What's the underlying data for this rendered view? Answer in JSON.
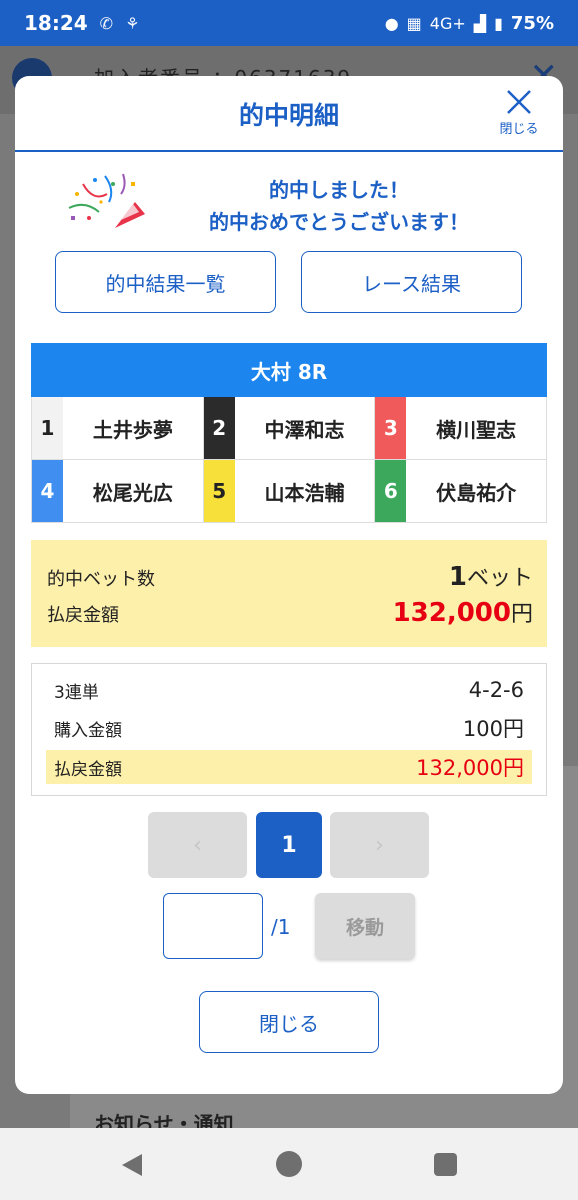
{
  "status_bar": {
    "time": "18:24",
    "network": "4G+",
    "battery": "75%"
  },
  "background": {
    "member_label": "加入者番号",
    "member_value": "：06371639",
    "notice_text": "お知らせ・通知"
  },
  "modal": {
    "title": "的中明細",
    "close_label": "閉じる",
    "congrats_line1": "的中しました！",
    "congrats_line2": "的中おめでとうございます！",
    "results_button": "的中結果一覧",
    "race_result_button": "レース結果"
  },
  "race": {
    "title": "大村 8R",
    "entries": [
      {
        "num": "1",
        "name": "土井歩夢",
        "bg": "#f2f2f2",
        "fg": "#222222"
      },
      {
        "num": "2",
        "name": "中澤和志",
        "bg": "#2b2b2b",
        "fg": "#ffffff"
      },
      {
        "num": "3",
        "name": "横川聖志",
        "bg": "#f05a5a",
        "fg": "#ffffff"
      },
      {
        "num": "4",
        "name": "松尾光広",
        "bg": "#3f8ef0",
        "fg": "#ffffff"
      },
      {
        "num": "5",
        "name": "山本浩輔",
        "bg": "#f7e03a",
        "fg": "#222222"
      },
      {
        "num": "6",
        "name": "伏島祐介",
        "bg": "#3ba85c",
        "fg": "#ffffff"
      }
    ]
  },
  "summary": {
    "hit_bets_label": "的中ベット数",
    "hit_bets_value": "1",
    "hit_bets_unit": "ベット",
    "payout_label": "払戻金額",
    "payout_value": "132,000",
    "payout_unit": "円"
  },
  "detail": {
    "bet_type": "3連単",
    "combination": "4-2-6",
    "purchase_label": "購入金額",
    "purchase_value": "100",
    "purchase_unit": "円",
    "payout_label": "払戻金額",
    "payout_value": "132,000",
    "payout_unit": "円"
  },
  "pager": {
    "prev": "‹",
    "current": "1",
    "next": "›",
    "total": "/1",
    "move_label": "移動",
    "page_input": ""
  },
  "footer": {
    "close_label": "閉じる"
  }
}
